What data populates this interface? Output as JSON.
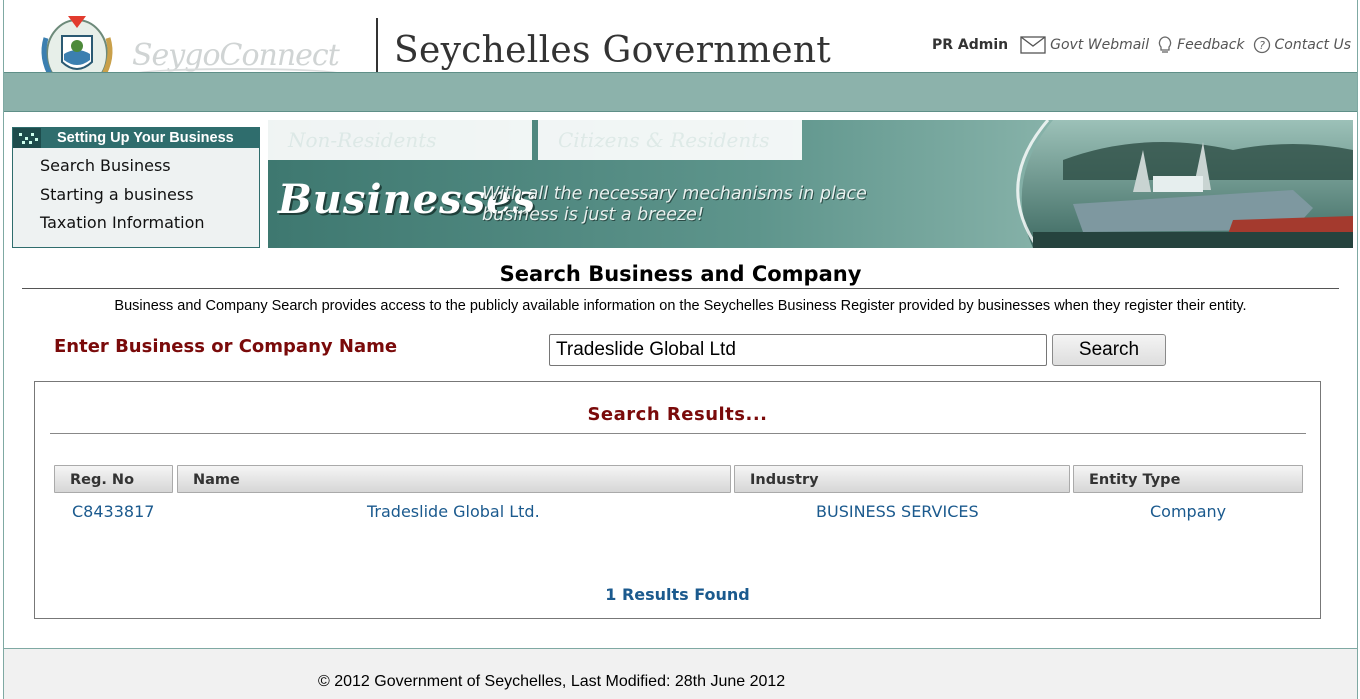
{
  "header": {
    "brand_logo_text": "SeygoConnect",
    "site_title": "Seychelles Government",
    "toplinks": {
      "admin": "PR Admin",
      "webmail": "Govt Webmail",
      "feedback": "Feedback",
      "contact": "Contact Us"
    }
  },
  "sidebar": {
    "heading": "Setting Up Your Business",
    "items": [
      {
        "label": "Search Business"
      },
      {
        "label": "Starting a business"
      },
      {
        "label": "Taxation Information"
      }
    ]
  },
  "banner": {
    "tabs": [
      "Non-Residents",
      "Citizens & Residents"
    ],
    "title": "Businesses",
    "slogan_line1": "With all the necessary mechanisms in place",
    "slogan_line2": "business is just a breeze!"
  },
  "main": {
    "title": "Search Business and Company",
    "description": "Business and Company Search provides access to the publicly available information on the Seychelles Business Register provided by businesses when they register their entity.",
    "search": {
      "label": "Enter Business or Company Name",
      "value": "Tradeslide Global Ltd",
      "button_label": "Search"
    },
    "results": {
      "title": "Search Results...",
      "columns": [
        "Reg. No",
        "Name",
        "Industry",
        "Entity Type"
      ],
      "rows": [
        {
          "reg_no": "C8433817",
          "name": "Tradeslide Global Ltd.",
          "industry": "BUSINESS SERVICES",
          "entity_type": "Company"
        }
      ],
      "count_text": "1 Results Found"
    }
  },
  "footer": {
    "copyright": "© 2012 Government of Seychelles, Last Modified: 28th June 2012"
  },
  "colors": {
    "teal_bar": "#8cb2ab",
    "nav_header": "#2f6d6d",
    "label_maroon": "#7a0a0a",
    "link_blue": "#1b5a8e"
  }
}
